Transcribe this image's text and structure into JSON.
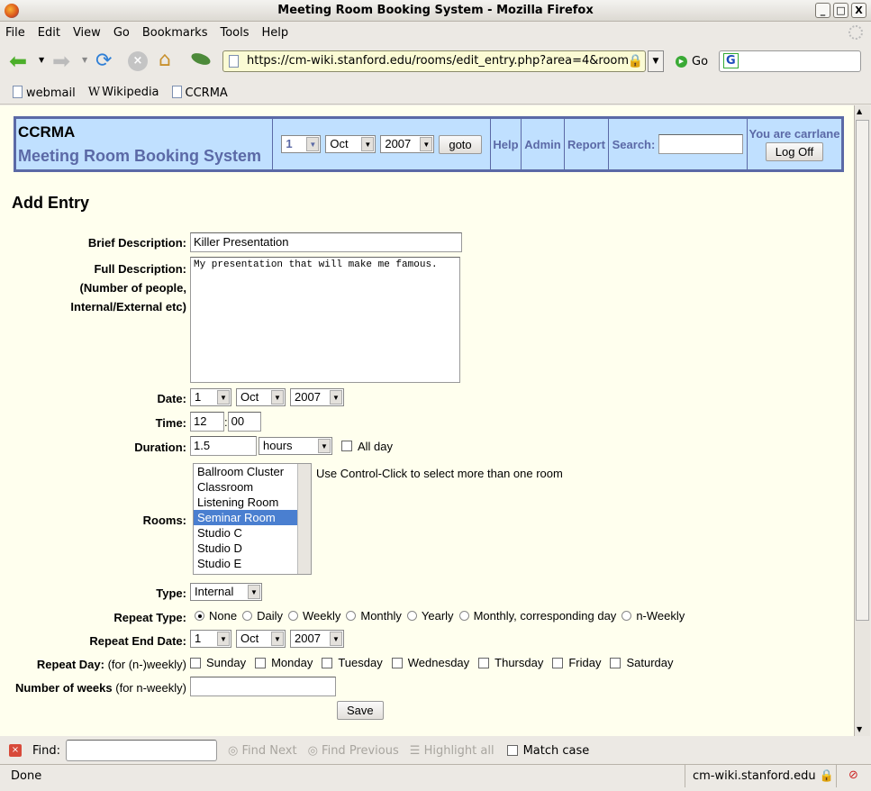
{
  "window": {
    "title": "Meeting Room Booking System - Mozilla Firefox"
  },
  "menu": [
    "File",
    "Edit",
    "View",
    "Go",
    "Bookmarks",
    "Tools",
    "Help"
  ],
  "nav": {
    "url": "https://cm-wiki.stanford.edu/rooms/edit_entry.php?area=4&room=",
    "go_label": "Go",
    "search_engine": "G"
  },
  "bookmarks": [
    "webmail",
    "Wikipedia",
    "CCRMA"
  ],
  "header": {
    "org": "CCRMA",
    "app_title": "Meeting Room Booking System",
    "day": "1",
    "month": "Oct",
    "year": "2007",
    "goto_label": "goto",
    "help": "Help",
    "admin": "Admin",
    "report": "Report",
    "search_label": "Search:",
    "user_text": "You are carrlane",
    "logoff_label": "Log Off",
    "accent": "#5b69a6",
    "header_bg": "#c0e0ff"
  },
  "form": {
    "heading": "Add Entry",
    "brief_label": "Brief Description:",
    "brief_value": "Killer Presentation",
    "full_label": "Full Description:",
    "full_label2": "(Number of people,",
    "full_label3": "Internal/External etc)",
    "full_value": "My presentation that will make me famous.",
    "date_label": "Date:",
    "date_day": "1",
    "date_month": "Oct",
    "date_year": "2007",
    "time_label": "Time:",
    "time_hour": "12",
    "time_sep": ":",
    "time_min": "00",
    "duration_label": "Duration:",
    "duration_value": "1.5",
    "duration_unit": "hours",
    "allday_label": "All day",
    "rooms_label": "Rooms:",
    "rooms": [
      "Ballroom Cluster",
      "Classroom",
      "Listening Room",
      "Seminar Room",
      "Studio C",
      "Studio D",
      "Studio E"
    ],
    "rooms_selected": "Seminar Room",
    "rooms_hint": "Use Control-Click to select more than one room",
    "type_label": "Type:",
    "type_value": "Internal",
    "repeat_type_label": "Repeat Type:",
    "repeat_types": [
      "None",
      "Daily",
      "Weekly",
      "Monthly",
      "Yearly",
      "Monthly, corresponding day",
      "n-Weekly"
    ],
    "repeat_type_selected": "None",
    "repeat_end_label": "Repeat End Date:",
    "end_day": "1",
    "end_month": "Oct",
    "end_year": "2007",
    "repeat_day_label": "Repeat Day:",
    "repeat_day_note": "(for (n-)weekly)",
    "days": [
      "Sunday",
      "Monday",
      "Tuesday",
      "Wednesday",
      "Thursday",
      "Friday",
      "Saturday"
    ],
    "weeks_label": "Number of weeks",
    "weeks_note": "(for n-weekly)",
    "weeks_value": "",
    "save_label": "Save"
  },
  "findbar": {
    "label": "Find:",
    "find_next": "Find Next",
    "find_previous": "Find Previous",
    "highlight_all": "Highlight all",
    "match_case": "Match case"
  },
  "status": {
    "text": "Done",
    "host": "cm-wiki.stanford.edu"
  }
}
